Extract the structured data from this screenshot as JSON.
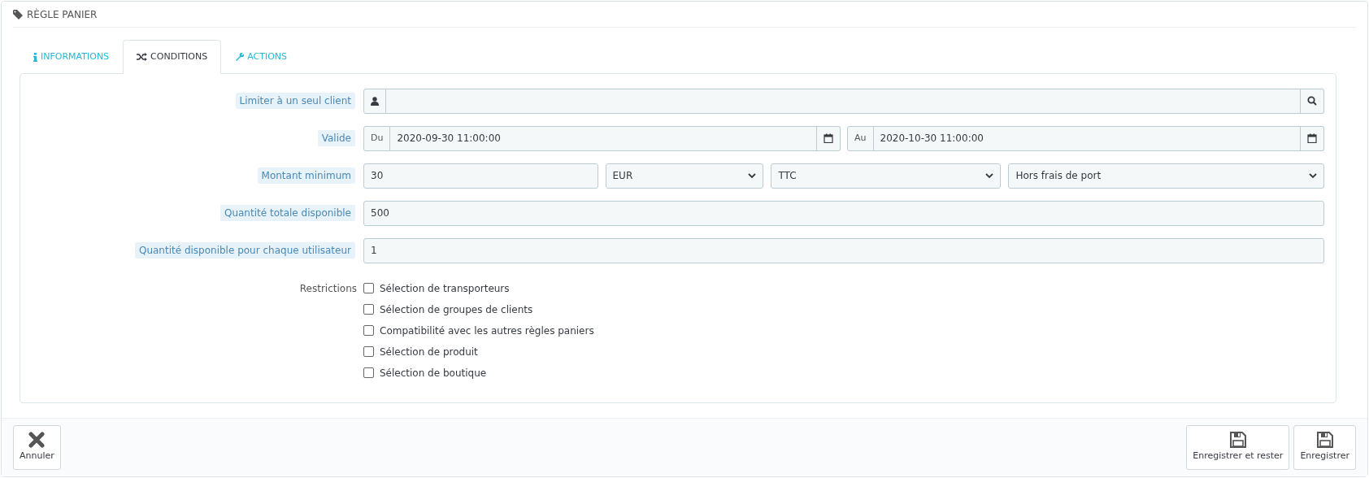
{
  "panel": {
    "title": "RÈGLE PANIER"
  },
  "tabs": [
    {
      "label": "INFORMATIONS",
      "selected": false
    },
    {
      "label": "CONDITIONS",
      "selected": true
    },
    {
      "label": "ACTIONS",
      "selected": false
    }
  ],
  "fields": [
    {
      "kind": "customer_search",
      "label": "Limiter à un seul client"
    },
    {
      "kind": "date_range",
      "label": "Valide",
      "from": {
        "prefix": "Du",
        "value": "2020-09-30 11:00:00"
      },
      "to": {
        "prefix": "Au",
        "value": "2020-10-30 11:00:00"
      }
    },
    {
      "kind": "amount",
      "label": "Montant minimum",
      "value": "30",
      "selects": [
        "EUR",
        "TTC",
        "Hors frais de port"
      ]
    },
    {
      "kind": "text",
      "label": "Quantité totale disponible",
      "value": "500"
    },
    {
      "kind": "text",
      "label": "Quantité disponible pour chaque utilisateur",
      "value": "1"
    }
  ],
  "restrictions": {
    "label": "Restrictions",
    "options": [
      {
        "label": "Sélection de transporteurs",
        "checked": false
      },
      {
        "label": "Sélection de groupes de clients",
        "checked": false
      },
      {
        "label": "Compatibilité avec les autres règles paniers",
        "checked": false
      },
      {
        "label": "Sélection de produit",
        "checked": false
      },
      {
        "label": "Sélection de boutique",
        "checked": false
      }
    ]
  },
  "footer": {
    "buttons": [
      {
        "label": "Annuler",
        "kind": "cancel"
      },
      {
        "label": "Enregistrer et rester",
        "kind": "save"
      },
      {
        "label": "Enregistrer",
        "kind": "save"
      }
    ]
  }
}
